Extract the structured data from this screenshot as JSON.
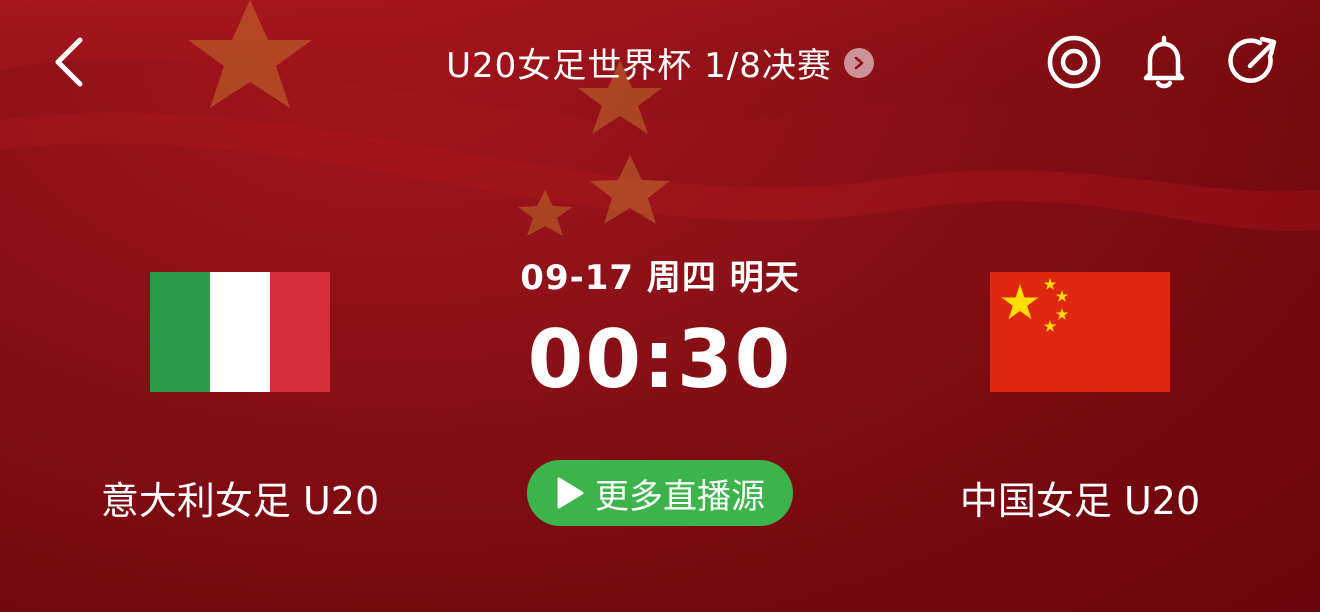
{
  "header": {
    "title": "U20女足世界杯 1/8决赛",
    "back_icon": "chevron-left-icon",
    "title_chevron_icon": "chevron-right-icon",
    "actions": [
      "target-icon",
      "bell-icon",
      "share-icon"
    ]
  },
  "match": {
    "date": "09-17 周四 明天",
    "time": "00:30",
    "live_button": "更多直播源",
    "home": {
      "name": "意大利女足 U20",
      "flag": "italy-flag"
    },
    "away": {
      "name": "中国女足 U20",
      "flag": "china-flag"
    }
  },
  "colors": {
    "background": "#8d1118",
    "live_button": "#3cb44b",
    "italy_green": "#2c9a46",
    "italy_white": "#ffffff",
    "italy_red": "#d42f3b",
    "china_red": "#de2910",
    "china_star": "#ffde00"
  }
}
